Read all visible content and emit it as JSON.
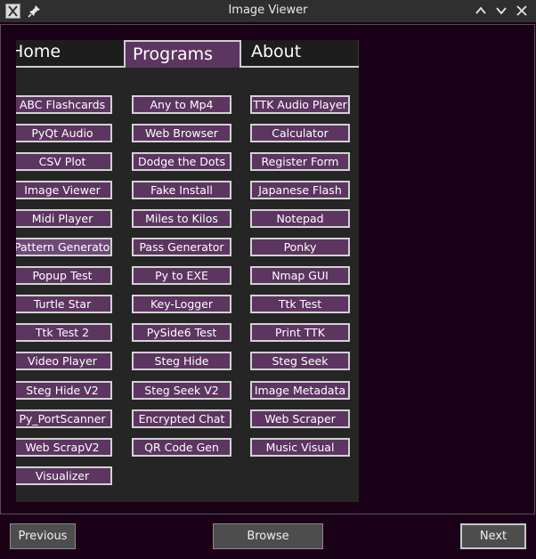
{
  "window": {
    "title": "Image Viewer",
    "icons": [
      "app-icon",
      "pin-icon",
      "minimize-icon",
      "restore-icon",
      "close-icon"
    ]
  },
  "tabs": {
    "home": "Home",
    "programs": "Programs",
    "about": "About",
    "active": "Programs"
  },
  "programs": {
    "column1": [
      "ABC Flashcards",
      "PyQt Audio",
      "CSV Plot",
      "Image Viewer",
      "Midi Player",
      "Pattern Generator",
      "Popup Test",
      "Turtle Star",
      "Ttk Test 2",
      "Video Player",
      "Steg Hide V2",
      "Py_PortScanner",
      "Web ScrapV2",
      "Visualizer"
    ],
    "column2": [
      "Any to Mp4",
      "Web Browser",
      "Dodge the Dots",
      "Fake Install",
      "Miles to Kilos",
      "Pass Generator",
      "Py to EXE",
      "Key-Logger",
      "PySide6 Test",
      "Steg Hide",
      "Steg Seek V2",
      "Encrypted Chat",
      "QR Code Gen"
    ],
    "column3": [
      "TTK Audio Player",
      "Calculator",
      "Register Form",
      "Japanese Flash",
      "Notepad",
      "Ponky",
      "Nmap GUI",
      "Ttk Test",
      "Print TTK",
      "Steg Seek",
      "Image Metadata",
      "Web Scraper",
      "Music Visual"
    ]
  },
  "colors": {
    "accent": "#5c3561",
    "window_bg": "#1b0118",
    "panel_bg": "#252525"
  },
  "nav": {
    "previous": "Previous",
    "browse": "Browse",
    "next": "Next"
  }
}
